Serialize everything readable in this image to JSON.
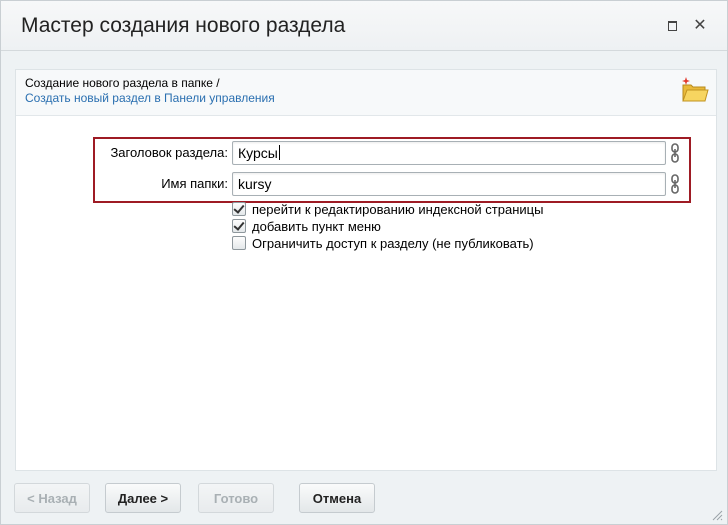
{
  "window": {
    "title": "Мастер создания нового раздела"
  },
  "info": {
    "line1": "Создание нового раздела в папке /",
    "link": "Создать новый раздел в Панели управления"
  },
  "form": {
    "section_title_label": "Заголовок раздела:",
    "section_title_value": "Курсы",
    "folder_name_label": "Имя папки:",
    "folder_name_value": "kursy"
  },
  "options": [
    {
      "label": "перейти к редактированию индексной страницы",
      "checked": true
    },
    {
      "label": "добавить пункт меню",
      "checked": true
    },
    {
      "label": "Ограничить доступ к разделу (не публиковать)",
      "checked": false
    }
  ],
  "buttons": {
    "back": "< Назад",
    "next": "Далее >",
    "done": "Готово",
    "cancel": "Отмена"
  },
  "icons": {
    "maximize": "maximize-icon",
    "close": "close-icon",
    "folder": "new-folder-icon",
    "chain": "link-chain-icon"
  },
  "colors": {
    "highlight_border": "#9e1b24",
    "link": "#2a6fb0",
    "dialog_bg": "#eef2f4"
  }
}
